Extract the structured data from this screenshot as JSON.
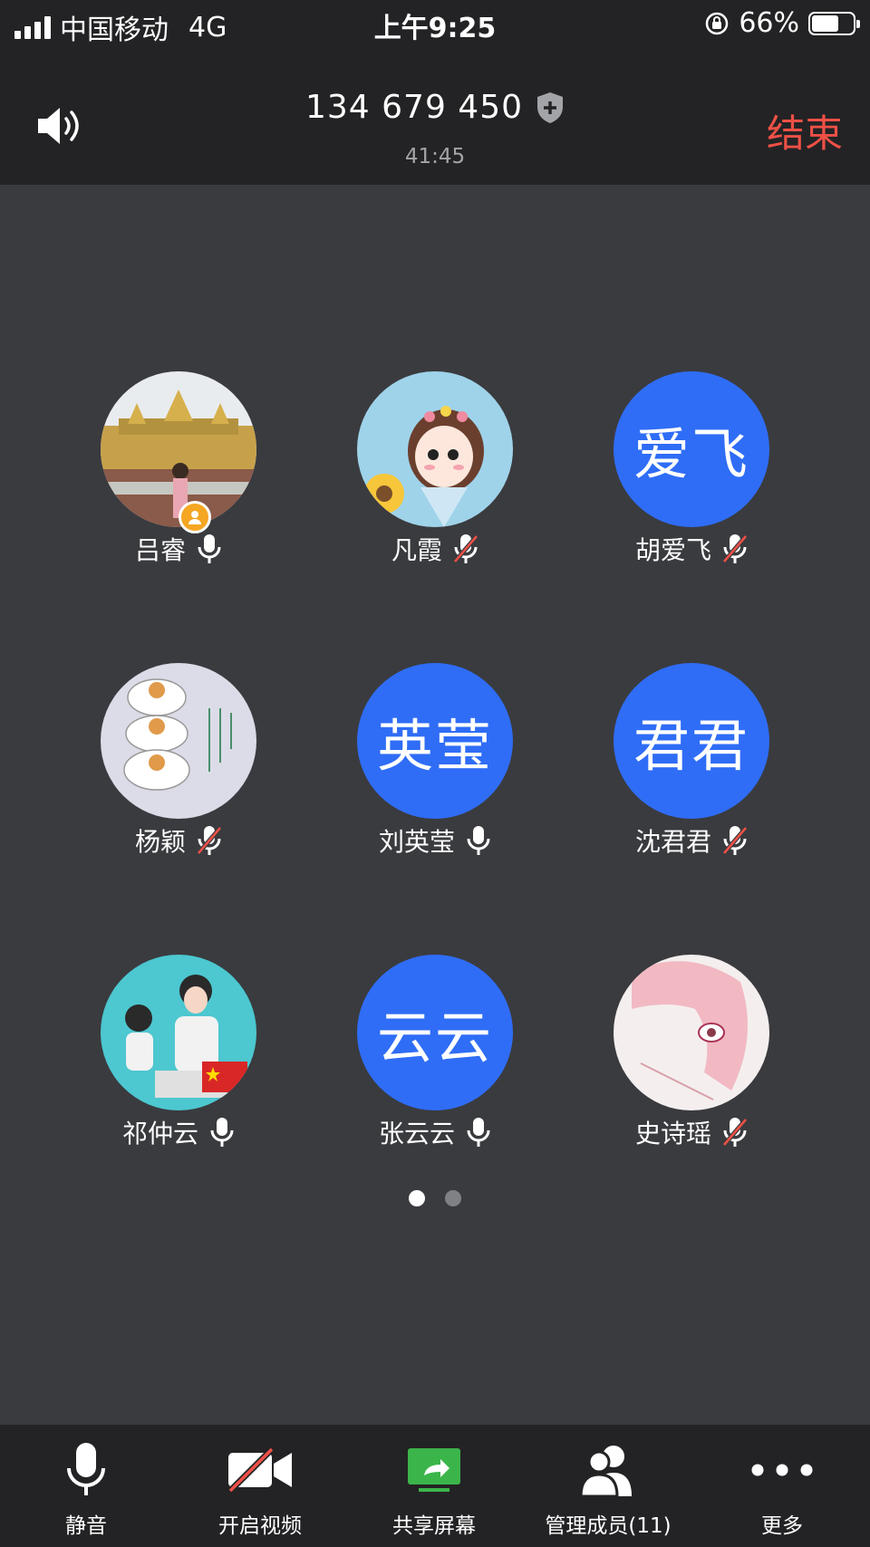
{
  "status_bar": {
    "carrier": "中国移动",
    "network": "4G",
    "time": "上午9:25",
    "battery_text": "66%",
    "battery_level": 0.66
  },
  "header": {
    "meeting_id": "134 679 450",
    "duration": "41:45",
    "end_label": "结束"
  },
  "participants": [
    {
      "name": "吕睿",
      "avatar_text": "",
      "mic": "on",
      "host": true
    },
    {
      "name": "凡霞",
      "avatar_text": "",
      "mic": "off"
    },
    {
      "name": "胡爱飞",
      "avatar_text": "爱飞",
      "mic": "off"
    },
    {
      "name": "杨颖",
      "avatar_text": "",
      "mic": "off"
    },
    {
      "name": "刘英莹",
      "avatar_text": "英莹",
      "mic": "on"
    },
    {
      "name": "沈君君",
      "avatar_text": "君君",
      "mic": "off"
    },
    {
      "name": "祁仲云",
      "avatar_text": "",
      "mic": "on"
    },
    {
      "name": "张云云",
      "avatar_text": "云云",
      "mic": "on"
    },
    {
      "name": "史诗瑶",
      "avatar_text": "",
      "mic": "off"
    }
  ],
  "pager": {
    "pages": 2,
    "current": 1
  },
  "toolbar": {
    "mute_label": "静音",
    "video_label": "开启视频",
    "share_label": "共享屏幕",
    "members_label": "管理成员(11)",
    "more_label": "更多"
  },
  "colors": {
    "background": "#3a3b3f",
    "bar": "#232325",
    "accent_blue": "#2f6df6",
    "end_red": "#ef5046",
    "share_green": "#3bb54a"
  }
}
